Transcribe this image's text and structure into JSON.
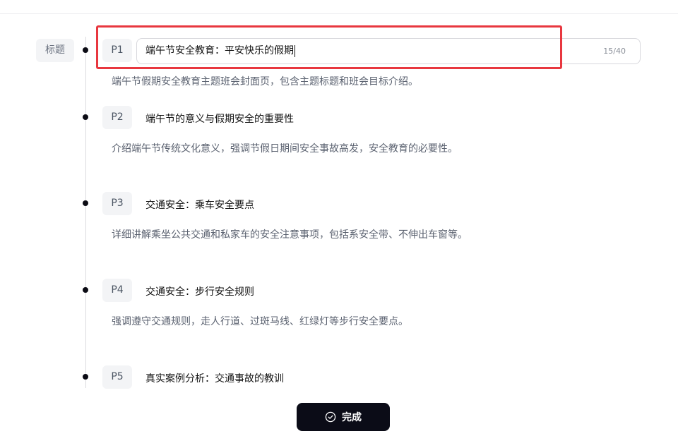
{
  "outline": {
    "section_label": "标题",
    "slides": [
      {
        "page": "P1",
        "title": "端午节安全教育：平安快乐的假期",
        "description": "端午节假期安全教育主题班会封面页，包含主题标题和班会目标介绍。",
        "char_count": "15/40"
      },
      {
        "page": "P2",
        "title": "端午节的意义与假期安全的重要性",
        "description": "介绍端午节传统文化意义，强调节假日期间安全事故高发，安全教育的必要性。"
      },
      {
        "page": "P3",
        "title": "交通安全：乘车安全要点",
        "description": "详细讲解乘坐公共交通和私家车的安全注意事项，包括系安全带、不伸出车窗等。"
      },
      {
        "page": "P4",
        "title": "交通安全：步行安全规则",
        "description": "强调遵守交通规则，走人行道、过斑马线、红绿灯等步行安全要点。"
      },
      {
        "page": "P5",
        "title": "真实案例分析：交通事故的教训",
        "description": ""
      }
    ]
  },
  "footer": {
    "done_label": "完成",
    "done_icon": "check-circle-icon"
  },
  "colors": {
    "highlight": "#e8373f",
    "button_bg": "#0b0c17"
  }
}
